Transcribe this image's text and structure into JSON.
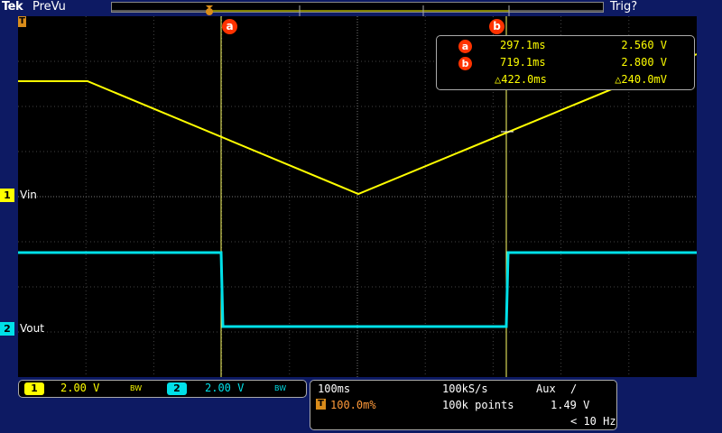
{
  "header": {
    "brand": "Tek",
    "mode": "PreVu",
    "trigger_status": "Trig?"
  },
  "channels": {
    "ch1": {
      "marker": "1",
      "label": "Vin",
      "scale": "2.00 V",
      "bw": "BW",
      "color": "#ffff00"
    },
    "ch2": {
      "marker": "2",
      "label": "Vout",
      "scale": "2.00 V",
      "bw": "BW",
      "color": "#00e0e8"
    }
  },
  "cursors": {
    "a": {
      "tag": "a",
      "time": "297.1ms",
      "value": "2.560 V"
    },
    "b": {
      "tag": "b",
      "time": "719.1ms",
      "value": "2.800 V"
    },
    "delta": {
      "time": "△422.0ms",
      "value": "△240.0mV"
    }
  },
  "trigger_marker": "T",
  "acquisition": {
    "timebase": "100ms",
    "sample_rate": "100kS/s",
    "trigger_source": "Aux",
    "trigger_slope": "/",
    "position_tag": "T",
    "position": "100.0m%",
    "record_length": "100k points",
    "trigger_level": "1.49 V",
    "freq": "< 10 Hz"
  }
}
